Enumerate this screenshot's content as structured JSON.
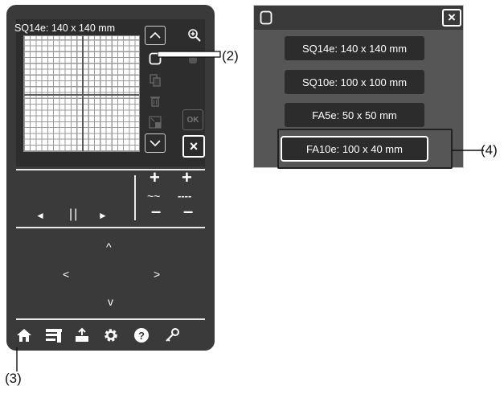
{
  "left_panel": {
    "frame_label": "SQ14e: 140 x 140 mm",
    "side_buttons": {
      "up": "^",
      "zoom_icon": "zoom-in-icon",
      "frame_icon": "frame-icon",
      "copy_icon": "copy-icon",
      "delete_icon": "delete-icon",
      "resize_icon": "resize-icon",
      "ok_label": "OK",
      "down": "v",
      "close": "×"
    },
    "playback": {
      "prev": "◄",
      "pause": "||",
      "next": "►"
    },
    "adjust": {
      "plus": "+",
      "minus": "–",
      "zigzag": "~~",
      "dashes": "----"
    },
    "arrows": {
      "up": "^",
      "left": "<",
      "right": ">",
      "down": "v"
    },
    "bottom_icons": [
      "home-icon",
      "sewing-icon",
      "export-icon",
      "gear-icon",
      "help-icon",
      "key-icon"
    ]
  },
  "callouts": {
    "c2": "(2)",
    "c3": "(3)",
    "c4": "(4)"
  },
  "dialog": {
    "close_label": "×",
    "sizes": [
      "SQ14e: 140 x 140 mm",
      "SQ10e: 100 x 100 mm",
      "FA5e: 50 x 50 mm",
      "FA10e: 100 x 40 mm"
    ],
    "selected_index": 3
  },
  "colors": {
    "panel_bg": "#3a3a3a",
    "dialog_bg": "#565656",
    "button_bg": "#2c2c2c"
  }
}
